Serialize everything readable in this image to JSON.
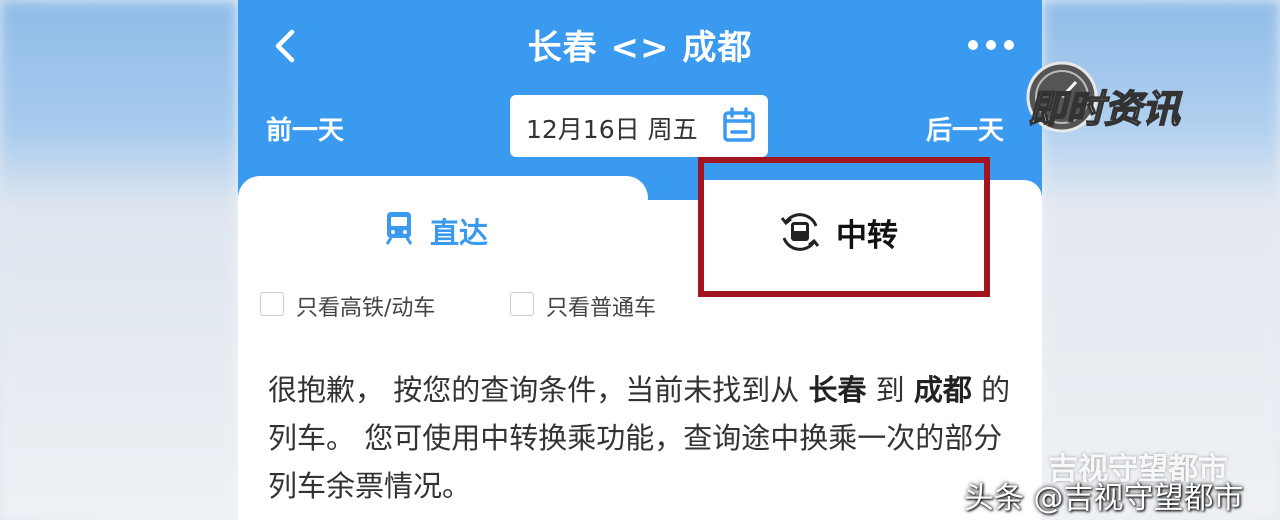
{
  "header": {
    "title": "长春 <> 成都",
    "prev_day": "前一天",
    "next_day": "后一天",
    "date": "12月16日 周五"
  },
  "tabs": {
    "direct": "直达",
    "transfer": "中转"
  },
  "filters": {
    "high_speed": "只看高铁/动车",
    "regular": "只看普通车"
  },
  "message": {
    "part1": "很抱歉， 按您的查询条件，当前未找到从 ",
    "from": "长春",
    "mid1": " 到 ",
    "to": "成都",
    "part2": " 的列车。 您可使用中转换乘功能，查询途中换乘一次的部分列车余票情况。"
  },
  "overlay": {
    "logo_text": "即时资讯",
    "watermark": "吉视守望都市",
    "footer": "头条 @吉视守望都市"
  },
  "colors": {
    "header_blue": "#3a9af0",
    "highlight_red": "#a2141e"
  }
}
